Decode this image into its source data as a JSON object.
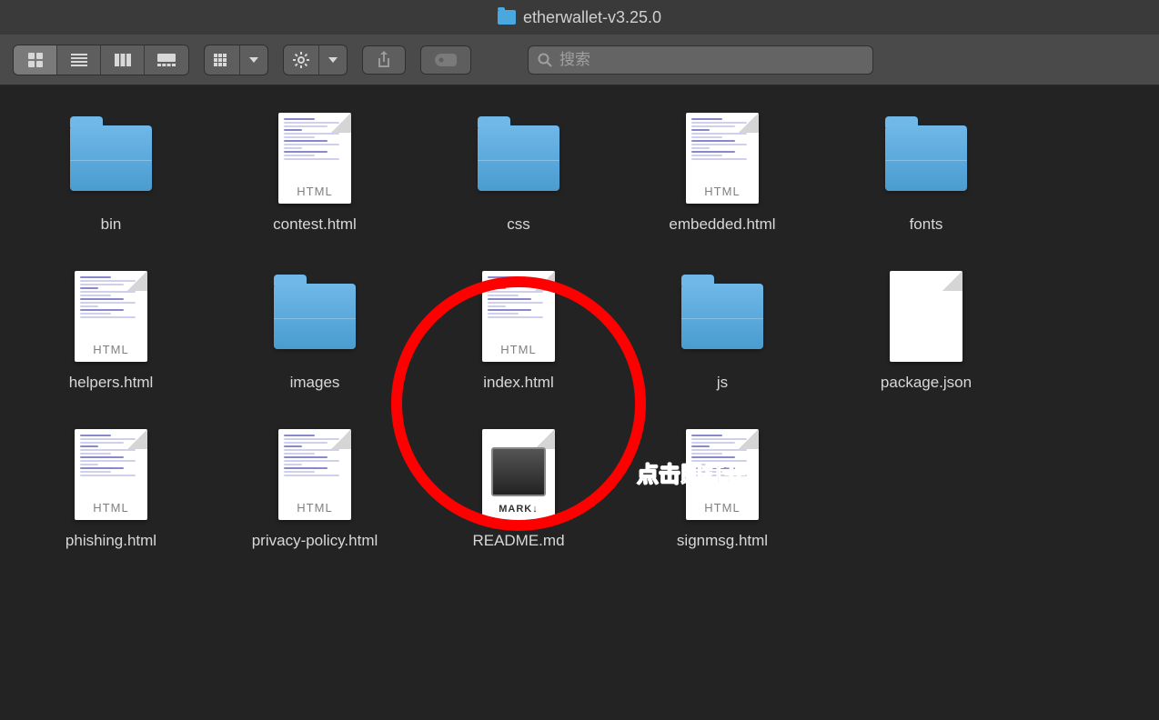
{
  "window": {
    "title": "etherwallet-v3.25.0"
  },
  "search": {
    "placeholder": "搜索"
  },
  "annotation": {
    "text": "点击即打开"
  },
  "items": [
    {
      "name": "bin",
      "type": "folder"
    },
    {
      "name": "contest.html",
      "type": "html"
    },
    {
      "name": "css",
      "type": "folder"
    },
    {
      "name": "embedded.html",
      "type": "html"
    },
    {
      "name": "fonts",
      "type": "folder"
    },
    {
      "name": "helpers.html",
      "type": "html"
    },
    {
      "name": "images",
      "type": "folder"
    },
    {
      "name": "index.html",
      "type": "html"
    },
    {
      "name": "js",
      "type": "folder"
    },
    {
      "name": "package.json",
      "type": "json"
    },
    {
      "name": "phishing.html",
      "type": "html"
    },
    {
      "name": "privacy-policy.html",
      "type": "html"
    },
    {
      "name": "README.md",
      "type": "md",
      "badge": "MARK↓"
    },
    {
      "name": "signmsg.html",
      "type": "html"
    }
  ]
}
